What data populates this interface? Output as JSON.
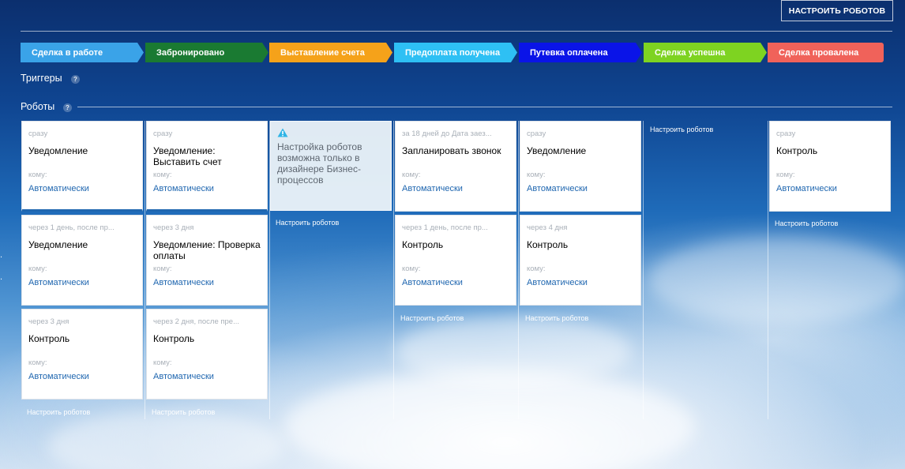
{
  "header": {
    "configure_robots_button": "НАСТРОИТЬ РОБОТОВ"
  },
  "stages": [
    {
      "label": "Сделка в работе",
      "color": "#3aa3e8"
    },
    {
      "label": "Забронировано",
      "color": "#1a7a32"
    },
    {
      "label": "Выставление счета",
      "color": "#f5a21a"
    },
    {
      "label": "Предоплата получена",
      "color": "#2ec0f4"
    },
    {
      "label": "Путевка оплачена",
      "color": "#0a14e8"
    },
    {
      "label": "Сделка успешна",
      "color": "#7ed321"
    },
    {
      "label": "Сделка провалена",
      "color": "#f0625a"
    }
  ],
  "sections": {
    "triggers": "Триггеры",
    "robots": "Роботы",
    "help": "?"
  },
  "columns": [
    {
      "cards": [
        {
          "delay": "сразу",
          "title": "Уведомление",
          "to": "кому:",
          "responsible": "Автоматически"
        },
        {
          "delay": "через 1 день, после пр...",
          "title": "Уведомление",
          "to": "кому:",
          "responsible": "Автоматически"
        },
        {
          "delay": "через 3 дня",
          "title": "Контроль",
          "to": "кому:",
          "responsible": "Автоматически"
        }
      ],
      "configure_link": "Настроить роботов"
    },
    {
      "cards": [
        {
          "delay": "сразу",
          "title": "Уведомление: Выставить счет",
          "to": "кому:",
          "responsible": "Автоматически"
        },
        {
          "delay": "через 3 дня",
          "title": "Уведомление: Проверка оплаты",
          "to": "кому:",
          "responsible": "Автоматически"
        },
        {
          "delay": "через 2 дня, после пре...",
          "title": "Контроль",
          "to": "кому:",
          "responsible": "Автоматически"
        }
      ],
      "configure_link": "Настроить роботов"
    },
    {
      "warning": "Настройка роботов возможна только в дизайнере Бизнес-процессов",
      "configure_link": "Настроить роботов"
    },
    {
      "cards": [
        {
          "delay": "за 18 дней до Дата заез...",
          "title": "Запланировать звонок",
          "to": "кому:",
          "responsible": "Автоматически"
        },
        {
          "delay": "через 1 день, после пр...",
          "title": "Контроль",
          "to": "кому:",
          "responsible": "Автоматически"
        }
      ],
      "configure_link": "Настроить роботов"
    },
    {
      "cards": [
        {
          "delay": "сразу",
          "title": "Уведомление",
          "to": "кому:",
          "responsible": "Автоматически"
        },
        {
          "delay": "через 4 дня",
          "title": "Контроль",
          "to": "кому:",
          "responsible": "Автоматически"
        }
      ],
      "configure_link": "Настроить роботов"
    },
    {
      "cards": [],
      "configure_link": "Настроить роботов"
    },
    {
      "cards": [
        {
          "delay": "сразу",
          "title": "Контроль",
          "to": "кому:",
          "responsible": "Автоматически"
        }
      ],
      "configure_link": "Настроить роботов"
    }
  ],
  "edge_marks": "."
}
